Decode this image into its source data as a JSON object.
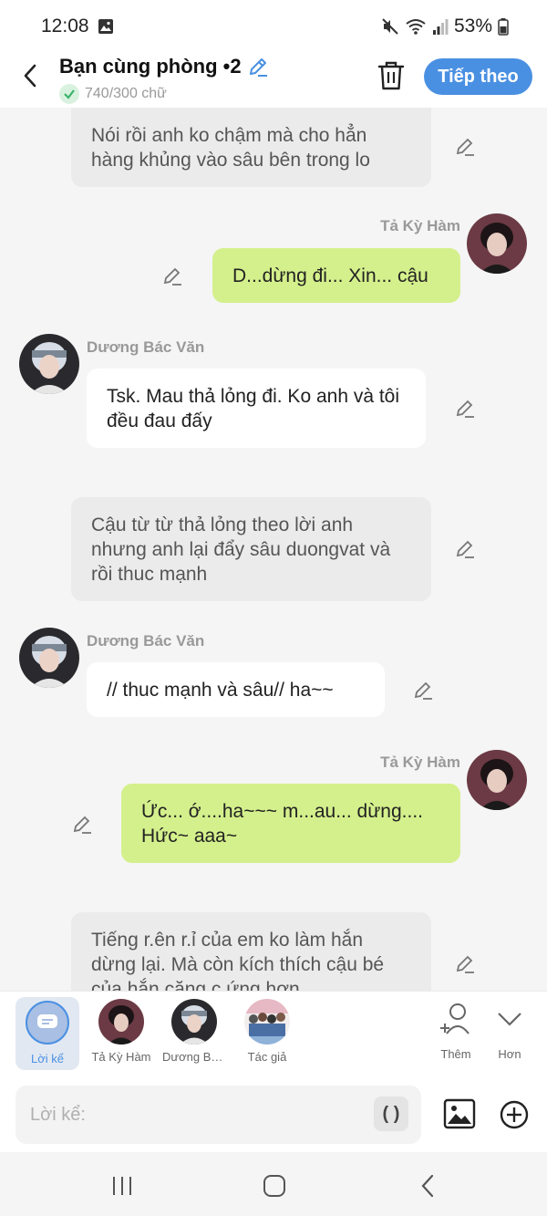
{
  "status_bar": {
    "time": "12:08",
    "battery": "53%"
  },
  "header": {
    "title": "Bạn cùng phòng •2",
    "word_count": "740/300 chữ",
    "next_label": "Tiếp theo"
  },
  "messages": [
    {
      "type": "narration",
      "text": "Nói rồi anh ko chậm mà cho hẳn hàng khủng vào sâu bên trong lo"
    },
    {
      "type": "right",
      "sender": "Tả Kỳ Hàm",
      "text": "D...dừng đi... Xin... cậu"
    },
    {
      "type": "left",
      "sender": "Dương Bác Văn",
      "text": "Tsk. Mau thả lỏng đi. Ko anh và tôi đều đau đấy"
    },
    {
      "type": "narration",
      "text": "Cậu từ từ thả lỏng theo lời anh nhưng anh lại đẩy sâu duongvat và rồi thuc mạnh"
    },
    {
      "type": "left",
      "sender": "Dương Bác Văn",
      "text": "// thuc mạnh và sâu// ha~~"
    },
    {
      "type": "right",
      "sender": "Tả Kỳ Hàm",
      "text": "Ức... ớ....ha~~~ m...au... dừng.... Hức~ aaa~"
    },
    {
      "type": "narration",
      "text": "Tiếng r.ên r.ỉ của em ko làm hắn dừng lại. Mà còn kích thích cậu bé của hắn căng c ứng hơn"
    }
  ],
  "tray": {
    "narrator_label": "Lời kể",
    "characters": [
      {
        "label": "Tả Kỳ Hàm"
      },
      {
        "label": "Dương Bá..."
      },
      {
        "label": "Tác giả"
      }
    ],
    "add_label": "Thêm",
    "more_label": "Hơn"
  },
  "input": {
    "placeholder": "Lời kể:",
    "paren_label": "( )"
  },
  "colors": {
    "accent": "#4a90e2",
    "right_bubble": "#d4f08c",
    "narration_bubble": "#ebebeb"
  },
  "icons": [
    "gallery-icon",
    "mute-icon",
    "wifi-icon",
    "signal-icon",
    "battery-icon",
    "back-icon",
    "pencil-icon",
    "check-icon",
    "trash-icon",
    "chat-icon",
    "add-person-icon",
    "chevron-down-icon",
    "image-icon",
    "plus-circle-icon",
    "recent-apps-icon",
    "home-icon",
    "nav-back-icon"
  ]
}
